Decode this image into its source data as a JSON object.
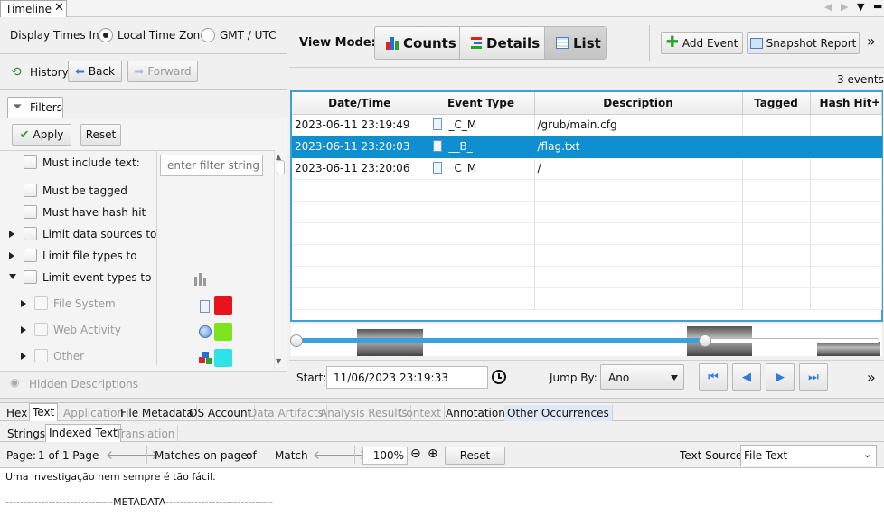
{
  "window_tab": {
    "label": "Timeline"
  },
  "display_times": {
    "label": "Display Times In:",
    "options": [
      {
        "label": "Local Time Zone",
        "selected": true
      },
      {
        "label": "GMT / UTC",
        "selected": false
      }
    ]
  },
  "history": {
    "label": "History",
    "back": "Back",
    "forward": "Forward"
  },
  "filters": {
    "tab_label": "Filters",
    "apply": "Apply",
    "reset": "Reset",
    "text_filter_label": "Must include text:",
    "text_filter_placeholder": "enter filter string",
    "items": [
      {
        "label": "Must be tagged"
      },
      {
        "label": "Must have hash hit"
      },
      {
        "label": "Limit data sources to"
      },
      {
        "label": "Limit file types to"
      },
      {
        "label": "Limit event types to"
      }
    ],
    "event_types": [
      {
        "label": "File System",
        "color": "#e8141b"
      },
      {
        "label": "Web Activity",
        "color": "#7fe31d"
      },
      {
        "label": "Other",
        "color": "#2ee3e8"
      }
    ],
    "hidden_descriptions": "Hidden Descriptions"
  },
  "toolbar": {
    "view_mode_label": "View Mode:",
    "modes": [
      {
        "label": "Counts",
        "active": false
      },
      {
        "label": "Details",
        "active": false
      },
      {
        "label": "List",
        "active": true
      }
    ],
    "add_event": "Add Event",
    "snapshot_report": "Snapshot Report",
    "more": "»"
  },
  "events_count": "3 events",
  "table": {
    "columns": [
      "Date/Time",
      "Event Type",
      "Description",
      "Tagged",
      "Hash Hit"
    ],
    "rows": [
      {
        "datetime": "2023-06-11 23:19:49",
        "type": "_C_M",
        "description": "/grub/main.cfg",
        "selected": false
      },
      {
        "datetime": "2023-06-11 23:20:03",
        "type": "__B_",
        "description": "/flag.txt",
        "selected": true
      },
      {
        "datetime": "2023-06-11 23:20:06",
        "type": "_C_M",
        "description": "/",
        "selected": false
      }
    ]
  },
  "time_range": {
    "start_label": "Start:",
    "start_value": "11/06/2023 23:19:33",
    "jump_by_label": "Jump By:",
    "jump_by_value": "Ano"
  },
  "bottom_tabs": {
    "main": [
      {
        "label": "Hex",
        "enabled": true
      },
      {
        "label": "Text",
        "enabled": true,
        "active": true
      },
      {
        "label": "Application",
        "enabled": false
      },
      {
        "label": "File Metadata",
        "enabled": true
      },
      {
        "label": "OS Account",
        "enabled": true
      },
      {
        "label": "Data Artifacts",
        "enabled": false
      },
      {
        "label": "Analysis Results",
        "enabled": false
      },
      {
        "label": "Context",
        "enabled": false
      },
      {
        "label": "Annotations",
        "enabled": true
      },
      {
        "label": "Other Occurrences",
        "enabled": true
      }
    ],
    "sub": [
      {
        "label": "Strings",
        "enabled": true
      },
      {
        "label": "Indexed Text",
        "enabled": true,
        "active": true
      },
      {
        "label": "Translation",
        "enabled": false
      }
    ]
  },
  "text_viewer": {
    "page_label": "Page:",
    "page_value": "1 of 1 Page",
    "matches_label": "Matches on page:",
    "matches_value": "- of -",
    "match_label": "Match",
    "zoom": "100%",
    "reset": "Reset",
    "text_source_label": "Text Source:",
    "text_source_value": "File Text",
    "content_line1": "Uma investigação nem sempre é tão fácil.",
    "content_line2": "------------------------------METADATA------------------------------"
  }
}
